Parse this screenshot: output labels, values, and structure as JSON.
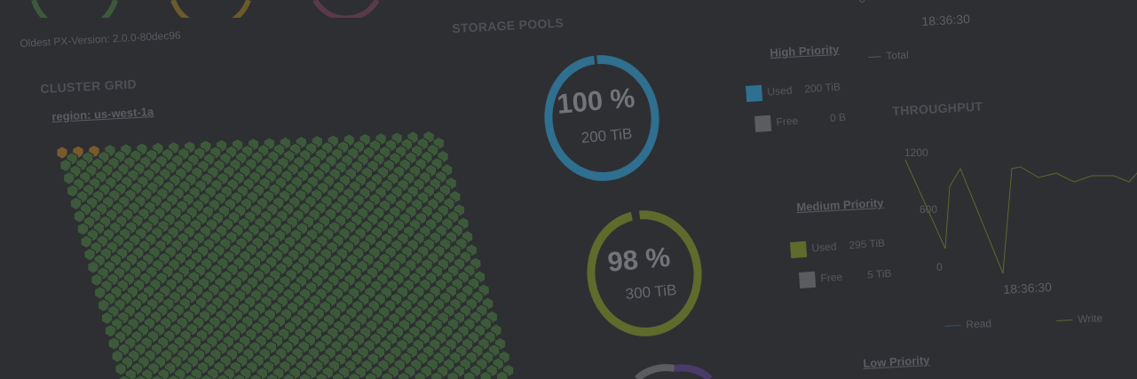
{
  "header": {
    "oldest_version": "Oldest PX-Version: 2.0.0-80dec96"
  },
  "cluster": {
    "title": "CLUSTER GRID",
    "region": "region: us-west-1a"
  },
  "storage": {
    "title": "STORAGE POOLS",
    "pools": [
      {
        "percent": "100 %",
        "capacity": "200 TiB",
        "color": "#2f6f8f",
        "fill": 1.0
      },
      {
        "percent": "98 %",
        "capacity": "300 TiB",
        "color": "#5f6a2c",
        "fill": 0.98
      }
    ]
  },
  "priorities": {
    "high": {
      "title": "High Priority",
      "used_label": "Used",
      "used_value": "200 TiB",
      "free_label": "Free",
      "free_value": "0 B",
      "used_color": "#2f6f8f",
      "free_color": "#5a5c60"
    },
    "medium": {
      "title": "Medium Priority",
      "used_label": "Used",
      "used_value": "295 TiB",
      "free_label": "Free",
      "free_value": "5 TiB",
      "used_color": "#5f6a2c",
      "free_color": "#5a5c60"
    },
    "low": {
      "title": "Low Priority"
    }
  },
  "top_chart": {
    "time": "18:36:30",
    "legend_total": "Total",
    "tick": "0"
  },
  "throughput": {
    "title": "THROUGHPUT",
    "y_ticks": [
      "1200",
      "600",
      "0"
    ],
    "x_tick": "18:36:30",
    "legend_read": "Read",
    "legend_write": "Write"
  },
  "colors": {
    "hex_node": "#3c5a3a",
    "hex_node_alert": "#7a5a2c",
    "write_line": "#5a6a2a",
    "read_line": "#2c5a6a"
  }
}
